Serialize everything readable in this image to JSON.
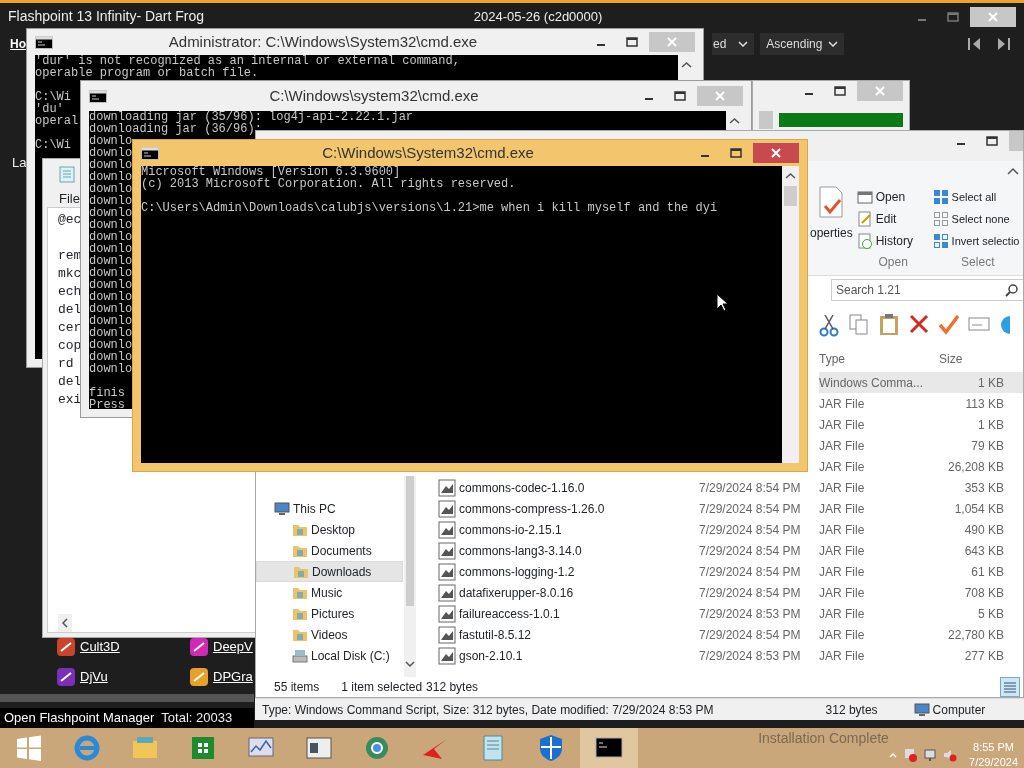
{
  "flashpoint": {
    "title": "Flashpoint 13 Infinity- Dart Frog",
    "build": "2024-05-26 (c2d0000)",
    "home_tab": "Ho",
    "sort_field": "ed",
    "sort_order": "Ascending",
    "side_label": "La",
    "games": [
      {
        "name": "Cult3D"
      },
      {
        "name": "DeepV"
      },
      {
        "name": "DjVu"
      },
      {
        "name": "DPGra"
      }
    ],
    "manager_button": "Open Flashpoint Manager",
    "total": "Total: 20033"
  },
  "admin_console": {
    "title": "Administrator: C:\\Windows\\System32\\cmd.exe",
    "blocks": [
      [
        "'dur' is not recognized as an internal or external command,",
        "operable program or batch file."
      ],
      [
        "C:\\Wi",
        "'du'",
        "operal"
      ],
      [
        "C:\\Wi"
      ]
    ]
  },
  "notepad": {
    "menu": [
      "File"
    ],
    "blocks": [
      [
        "@ec"
      ],
      [
        "rem",
        "mkc",
        "ech",
        "del",
        "cer",
        "cop",
        "rd",
        "del",
        "exi"
      ]
    ]
  },
  "download_console": {
    "title": "C:\\Windows\\system32\\cmd.exe",
    "blocks": [
      [
        "downloading jar (35/96): log4j-api-2.22.1.jar",
        "downloading jar (36/96):",
        "downlo",
        "downlo",
        "downlo",
        "downlo",
        "downlo",
        "downlo",
        "downlo",
        "downlo",
        "downlo",
        "downlo",
        "downlo",
        "downlo",
        "downlo",
        "downlo",
        "downlo",
        "downlo",
        "downlo",
        "downlo",
        "downlo",
        "downlo"
      ],
      [
        "finis",
        "Press"
      ]
    ]
  },
  "progress_window": {
    "level": 1
  },
  "explorer": {
    "ribbon": {
      "properties": "operties",
      "open_items": [
        "Open",
        "Edit",
        "History"
      ],
      "open_group": "Open",
      "select_items": [
        "Select all",
        "Select none",
        "Invert selectio"
      ],
      "select_group": "Select"
    },
    "search": {
      "placeholder": "Search 1.21"
    },
    "columns": [
      "Type",
      "Size"
    ],
    "rows": [
      {
        "type": "Windows Comma...",
        "size": "1 KB",
        "selected": true
      },
      {
        "type": "JAR File",
        "size": "113 KB",
        "selected": false
      },
      {
        "type": "JAR File",
        "size": "1 KB",
        "selected": false
      },
      {
        "type": "JAR File",
        "size": "79 KB",
        "selected": false
      },
      {
        "type": "JAR File",
        "size": "26,208 KB",
        "selected": false
      },
      {
        "name": "commons-codec-1.16.0",
        "date": "7/29/2024 8:54 PM",
        "type": "JAR File",
        "size": "353 KB",
        "selected": false
      },
      {
        "name": "commons-compress-1.26.0",
        "date": "7/29/2024 8:54 PM",
        "type": "JAR File",
        "size": "1,054 KB",
        "selected": false
      },
      {
        "name": "commons-io-2.15.1",
        "date": "7/29/2024 8:54 PM",
        "type": "JAR File",
        "size": "490 KB",
        "selected": false
      },
      {
        "name": "commons-lang3-3.14.0",
        "date": "7/29/2024 8:54 PM",
        "type": "JAR File",
        "size": "643 KB",
        "selected": false
      },
      {
        "name": "commons-logging-1.2",
        "date": "7/29/2024 8:54 PM",
        "type": "JAR File",
        "size": "61 KB",
        "selected": false
      },
      {
        "name": "datafixerupper-8.0.16",
        "date": "7/29/2024 8:54 PM",
        "type": "JAR File",
        "size": "708 KB",
        "selected": false
      },
      {
        "name": "failureaccess-1.0.1",
        "date": "7/29/2024 8:53 PM",
        "type": "JAR File",
        "size": "5 KB",
        "selected": false
      },
      {
        "name": "fastutil-8.5.12",
        "date": "7/29/2024 8:54 PM",
        "type": "JAR File",
        "size": "22,780 KB",
        "selected": false
      },
      {
        "name": "gson-2.10.1",
        "date": "7/29/2024 8:53 PM",
        "type": "JAR File",
        "size": "277 KB",
        "selected": false
      }
    ],
    "nav": [
      {
        "label": "This PC",
        "kind": "pc",
        "selected": false,
        "children": [
          {
            "label": "Desktop",
            "kind": "folder",
            "selected": false
          },
          {
            "label": "Documents",
            "kind": "folder",
            "selected": false
          },
          {
            "label": "Downloads",
            "kind": "folder",
            "selected": true
          },
          {
            "label": "Music",
            "kind": "folder",
            "selected": false
          },
          {
            "label": "Pictures",
            "kind": "folder",
            "selected": false
          },
          {
            "label": "Videos",
            "kind": "folder",
            "selected": false
          },
          {
            "label": "Local Disk (C:)",
            "kind": "drive",
            "selected": false
          }
        ]
      }
    ],
    "status": {
      "items": "55 items",
      "selection": "1 item selected",
      "bytes": "312 bytes"
    }
  },
  "details_bar": {
    "info": "Type: Windows Command Script, Size: 312 bytes, Date modified: 7/29/2024 8:53 PM",
    "size": "312 bytes",
    "location": "Computer"
  },
  "active_console": {
    "title": "C:\\Windows\\System32\\cmd.exe",
    "blocks": [
      [
        "Microsoft Windows [Version 6.3.9600]",
        "(c) 2013 Microsoft Corporation. All rights reserved."
      ],
      [
        "C:\\Users\\Admin\\Downloads\\calubjs\\versions\\1.21>me when i kill myself and the dyi"
      ]
    ]
  },
  "taskbar": {
    "notice": "Installation Complete",
    "time": "8:55 PM",
    "date": "7/29/2024"
  }
}
